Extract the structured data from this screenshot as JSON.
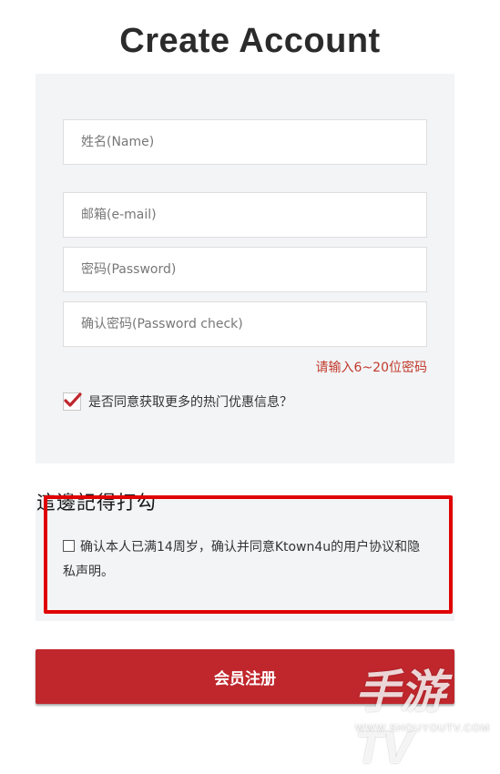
{
  "page": {
    "title": "Create Account"
  },
  "form": {
    "name_placeholder": "姓名(Name)",
    "email_placeholder": "邮箱(e-mail)",
    "password_placeholder": "密码(Password)",
    "password_check_placeholder": "确认密码(Password check)",
    "password_hint": "请输入6~20位密码",
    "promo_checked": true,
    "promo_label": "是否同意获取更多的热门优惠信息？"
  },
  "annotation": {
    "text": "這邊記得打勾",
    "frame_color": "#e00000"
  },
  "agreement": {
    "checked": false,
    "text": "确认本人已满14周岁，确认并同意Ktown4u的用户协议和隐私声明。"
  },
  "submit": {
    "label": "会员注册",
    "color": "#c0272d"
  },
  "watermark": {
    "logo": "手游TV",
    "url": "WWW.SHOUYOUTV.COM"
  }
}
